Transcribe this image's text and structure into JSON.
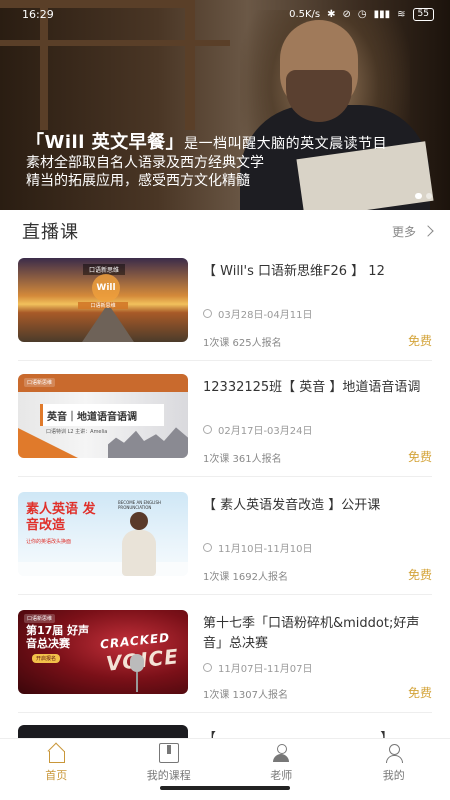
{
  "status_bar": {
    "time": "16:29",
    "speed": "0.5K/s",
    "battery": "55"
  },
  "banner": {
    "title": "「Will 英文早餐」",
    "title_suffix": "是一档叫醒大脑的英文晨读节目",
    "line1": "素材全部取自名人语录及西方经典文学",
    "line2": "精当的拓展应用，感受西方文化精髓",
    "dots_count": 2,
    "active_dot": 1
  },
  "section": {
    "title": "直播课",
    "more_label": "更多"
  },
  "courses": [
    {
      "title": "【 Will's 口语新思维F26 】 12",
      "date": "03月28日-04月11日",
      "meta": "1次课  625人报名",
      "price": "免费",
      "thumb": {
        "brand": "口语新思维",
        "center": "Will",
        "tag": "口语新思维"
      }
    },
    {
      "title": "12332125班【 英音 】地道语音语调",
      "date": "02月17日-03月24日",
      "meta": "1次课  361人报名",
      "price": "免费",
      "thumb": {
        "brand": "口语新思维",
        "headline": "英音｜地道语音语调",
        "sub": "口语特训 L2  主讲：Amelia"
      }
    },
    {
      "title": "【 素人英语发音改造 】公开课",
      "date": "11月10日-11月10日",
      "meta": "1次课  1692人报名",
      "price": "免费",
      "thumb": {
        "headline": "素人英语 发音改造",
        "sub": "让你的英语改头换面",
        "en": "BECOME AN ENGLISH PRONUNCIATION"
      }
    },
    {
      "title": "第十七季「口语粉碎机&middot;好声音」总决赛",
      "date": "11月07日-11月07日",
      "meta": "1次课  1307人报名",
      "price": "免费",
      "thumb": {
        "brand": "口语新思维",
        "headline": "第17届 好声音总决赛",
        "pill": "开启报名",
        "word1": "CRACKED",
        "word2": "VOICE"
      }
    },
    {
      "title": "【 ……………………………… 】",
      "date": "",
      "meta": "",
      "price": ""
    }
  ],
  "tabs": [
    {
      "label": "首页",
      "icon": "home-icon",
      "active": true
    },
    {
      "label": "我的课程",
      "icon": "book-icon",
      "active": false
    },
    {
      "label": "老师",
      "icon": "teacher-icon",
      "active": false
    },
    {
      "label": "我的",
      "icon": "user-icon",
      "active": false
    }
  ],
  "colors": {
    "accent": "#c9973a",
    "price": "#d4a43a"
  }
}
